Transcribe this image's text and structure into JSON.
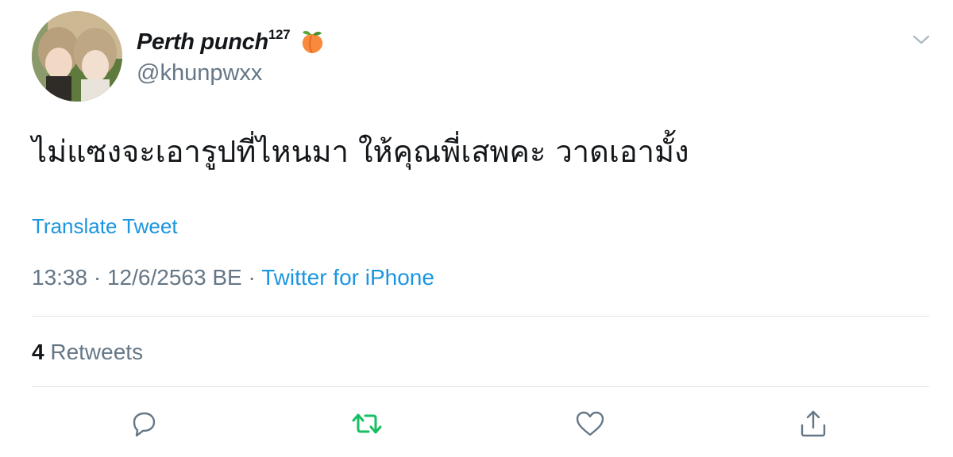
{
  "user": {
    "display_name": "Perth punch",
    "display_name_superscript": "127",
    "name_emoji": "peach-emoji",
    "handle": "@khunpwxx"
  },
  "tweet": {
    "text": "ไม่แซงจะเอารูปที่ไหนมา ให้คุณพี่เสพคะ วาดเอามั้ง",
    "translate_label": "Translate Tweet",
    "time": "13:38",
    "date": "12/6/2563 BE",
    "separator": "·",
    "source": "Twitter for iPhone"
  },
  "stats": {
    "retweet_count": "4",
    "retweet_label": "Retweets"
  },
  "actions": [
    "reply-icon",
    "retweet-icon",
    "like-icon",
    "share-icon"
  ],
  "colors": {
    "link": "#1b95e0",
    "secondary_text": "#657786",
    "primary_text": "#14171a",
    "retweet_green": "#17bf63",
    "divider": "#dfe3e6"
  }
}
